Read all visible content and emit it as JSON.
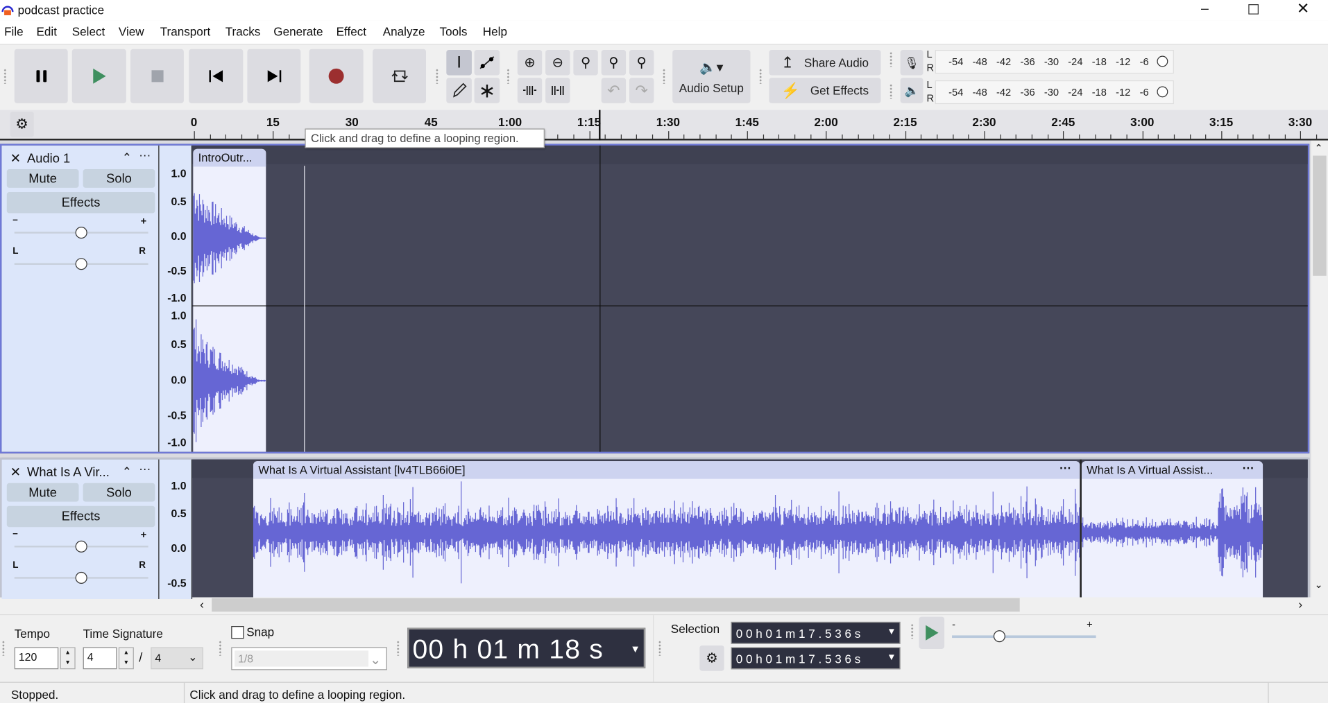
{
  "window": {
    "title": "podcast practice",
    "controls": [
      "minimize-icon",
      "restore-icon",
      "close-icon"
    ]
  },
  "menu": [
    "File",
    "Edit",
    "Select",
    "View",
    "Transport",
    "Tracks",
    "Generate",
    "Effect",
    "Analyze",
    "Tools",
    "Help"
  ],
  "toolbar": {
    "transport": [
      "pause-icon",
      "play-icon",
      "stop-icon",
      "skip-start-icon",
      "skip-end-icon",
      "record-icon",
      "loop-icon"
    ],
    "audio_setup": "Audio Setup",
    "share_audio": "Share Audio",
    "get_effects": "Get Effects",
    "meter_scale": [
      "-54",
      "-48",
      "-42",
      "-36",
      "-30",
      "-24",
      "-18",
      "-12",
      "-6"
    ],
    "meter_lr": [
      "L",
      "R"
    ]
  },
  "ruler": {
    "ticks": [
      "0",
      "15",
      "30",
      "45",
      "1:00",
      "1:15",
      "1:30",
      "1:45",
      "2:00",
      "2:15",
      "2:30",
      "2:45",
      "3:00",
      "3:15",
      "3:30"
    ]
  },
  "tooltip": "Click and drag to define a looping region.",
  "tracks": [
    {
      "name": "Audio 1",
      "mute": "Mute",
      "solo": "Solo",
      "effects": "Effects",
      "gain_minus": "–",
      "gain_plus": "+",
      "pan_l": "L",
      "pan_r": "R",
      "gain": 0.5,
      "pan": 0.5,
      "scale": [
        "1.0",
        "0.5",
        "0.0",
        "-0.5",
        "-1.0"
      ],
      "clips": [
        {
          "name": "IntroOutr..."
        }
      ]
    },
    {
      "name": "What Is A Vir...",
      "mute": "Mute",
      "solo": "Solo",
      "effects": "Effects",
      "gain_minus": "–",
      "gain_plus": "+",
      "pan_l": "L",
      "pan_r": "R",
      "gain": 0.5,
      "pan": 0.5,
      "scale": [
        "1.0",
        "0.5",
        "0.0",
        "-0.5"
      ],
      "clips": [
        {
          "name": "What Is A Virtual Assistant [lv4TLB66i0E]"
        },
        {
          "name": "What Is A Virtual Assist..."
        }
      ]
    }
  ],
  "bottom": {
    "tempo_label": "Tempo",
    "tempo": "120",
    "timesig_label": "Time Signature",
    "timesig_num": "4",
    "timesig_sep": "/",
    "timesig_den": "4",
    "snap_label": "Snap",
    "snap_checked": false,
    "snap_value": "1/8",
    "time": "00 h 01 m 18 s",
    "selection_label": "Selection",
    "sel_start": "0 0 h 0 1 m 1 7 . 5 3 6 s",
    "sel_end": "0 0 h 0 1 m 1 7 . 5 3 6 s",
    "speed_minus": "-",
    "speed_plus": "+"
  },
  "status": {
    "left": "Stopped.",
    "right": "Click and drag to define a looping region."
  },
  "colors": {
    "waveform": "#6666d4",
    "track_bg": "#454759",
    "header_bg": "#dce6fa",
    "record": "#9c2f2f",
    "play": "#3f8f5f"
  }
}
